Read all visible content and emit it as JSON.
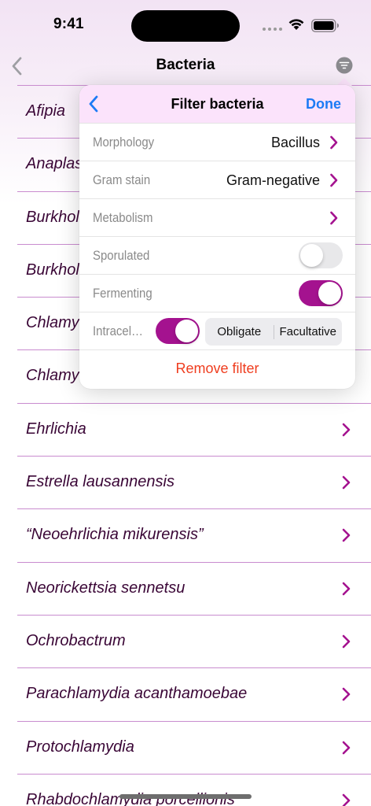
{
  "status_bar": {
    "time": "9:41"
  },
  "nav": {
    "title": "Bacteria",
    "back_icon": "chevron-left-icon",
    "filter_icon": "filter-icon"
  },
  "list": {
    "items": [
      {
        "label": "Afipia"
      },
      {
        "label": "Anaplasma"
      },
      {
        "label": "Burkholderia"
      },
      {
        "label": "Burkholderia"
      },
      {
        "label": "Chlamydia"
      },
      {
        "label": "Chlamydia"
      },
      {
        "label": "Ehrlichia"
      },
      {
        "label": "Estrella lausannensis"
      },
      {
        "label": "“Neoehrlichia mikurensis”"
      },
      {
        "label": "Neorickettsia sennetsu"
      },
      {
        "label": "Ochrobactrum"
      },
      {
        "label": "Parachlamydia acanthamoebae"
      },
      {
        "label": "Protochlamydia"
      },
      {
        "label": "Rhabdochlamydia porcellionis"
      }
    ]
  },
  "filter_popover": {
    "title": "Filter bacteria",
    "done_label": "Done",
    "rows": {
      "morphology": {
        "label": "Morphology",
        "value": "Bacillus"
      },
      "gram_stain": {
        "label": "Gram stain",
        "value": "Gram-negative"
      },
      "metabolism": {
        "label": "Metabolism",
        "value": ""
      },
      "sporulated": {
        "label": "Sporulated",
        "on": false
      },
      "fermenting": {
        "label": "Fermenting",
        "on": true
      },
      "intracellular": {
        "label": "Intracel…",
        "on": true,
        "options": [
          "Obligate",
          "Facultative"
        ]
      }
    },
    "remove_label": "Remove filter"
  },
  "colors": {
    "accent": "#a4128f",
    "link_blue": "#1c7bf5",
    "destructive": "#ef3d1f",
    "list_text": "#3a0636",
    "header_tint": "#fbe3fb"
  }
}
